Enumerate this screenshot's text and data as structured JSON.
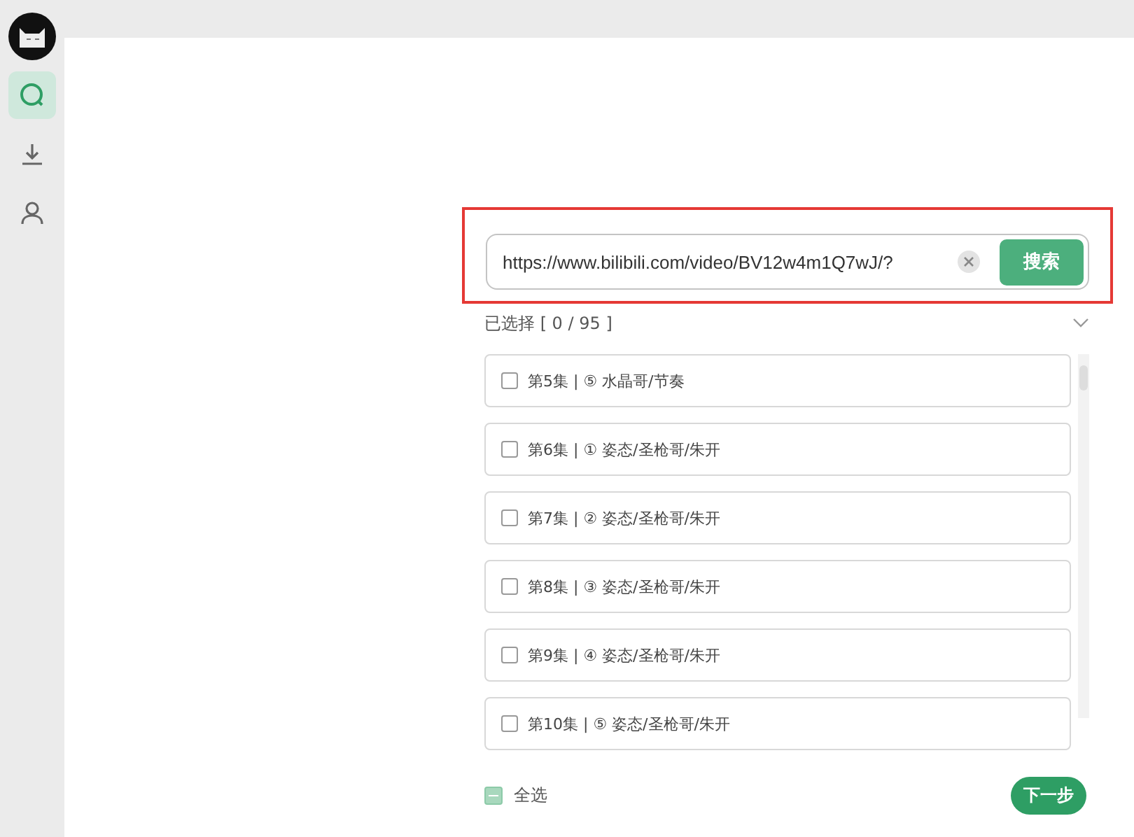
{
  "sidebar": {
    "items": [
      {
        "kind": "search",
        "selected": true
      },
      {
        "kind": "download",
        "selected": false
      },
      {
        "kind": "user",
        "selected": false
      }
    ]
  },
  "search": {
    "value": "https://www.bilibili.com/video/BV12w4m1Q7wJ/?",
    "button": "搜索",
    "highlighted": true
  },
  "selection": {
    "summary": "已选择 [ 0 / 95 ]",
    "expanded": true
  },
  "episodes": [
    {
      "label": "第5集 | ⑤ 水晶哥/节奏",
      "checked": false
    },
    {
      "label": "第6集 | ① 姿态/圣枪哥/朱开",
      "checked": false
    },
    {
      "label": "第7集 | ② 姿态/圣枪哥/朱开",
      "checked": false
    },
    {
      "label": "第8集 | ③ 姿态/圣枪哥/朱开",
      "checked": false
    },
    {
      "label": "第9集 | ④ 姿态/圣枪哥/朱开",
      "checked": false
    },
    {
      "label": "第10集 | ⑤ 姿态/圣枪哥/朱开",
      "checked": false
    }
  ],
  "select_all": {
    "label": "全选",
    "indeterminate": true
  },
  "next_button": "下一步"
}
